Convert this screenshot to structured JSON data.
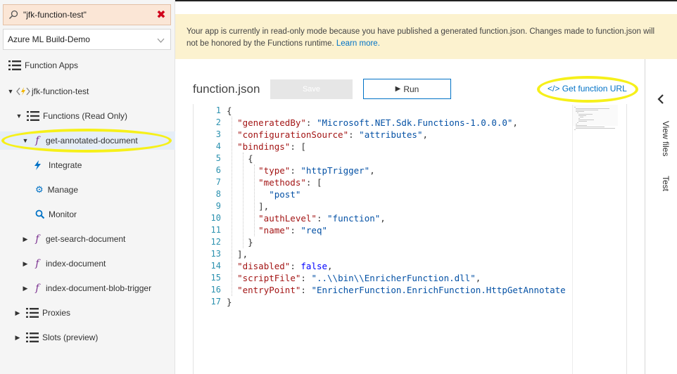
{
  "sidebar": {
    "search_value": "\"jfk-function-test\"",
    "subscription": "Azure ML Build-Demo",
    "function_apps_label": "Function Apps",
    "app_name": "jfk-function-test",
    "functions_label": "Functions (Read Only)",
    "selected_function": "get-annotated-document",
    "integrate_label": "Integrate",
    "manage_label": "Manage",
    "monitor_label": "Monitor",
    "other_functions": [
      "get-search-document",
      "index-document",
      "index-document-blob-trigger"
    ],
    "proxies_label": "Proxies",
    "slots_label": "Slots (preview)"
  },
  "banner": {
    "text": "Your app is currently in read-only mode because you have published a generated function.json. Changes made to function.json will not be honored by the Functions runtime.",
    "link": "Learn more."
  },
  "editor": {
    "title": "function.json",
    "save_label": "Save",
    "run_label": "Run",
    "get_url_label": "Get function URL",
    "line_numbers": [
      "1",
      "2",
      "3",
      "4",
      "5",
      "6",
      "7",
      "8",
      "9",
      "10",
      "11",
      "12",
      "13",
      "14",
      "15",
      "16",
      "17"
    ],
    "lines": [
      "{",
      "  \"generatedBy\": \"Microsoft.NET.Sdk.Functions-1.0.0.0\",",
      "  \"configurationSource\": \"attributes\",",
      "  \"bindings\": [",
      "    {",
      "      \"type\": \"httpTrigger\",",
      "      \"methods\": [",
      "        \"post\"",
      "      ],",
      "      \"authLevel\": \"function\",",
      "      \"name\": \"req\"",
      "    }",
      "  ],",
      "  \"disabled\": false,",
      "  \"scriptFile\": \"..\\\\bin\\\\EnricherFunction.dll\",",
      "  \"entryPoint\": \"EnricherFunction.EnrichFunction.HttpGetAnnotate",
      "}"
    ]
  },
  "right_rail": {
    "view_files_label": "View files",
    "test_label": "Test"
  },
  "colors": {
    "banner_bg": "#fcf2cf",
    "accent": "#0072c6",
    "highlight": "#f6f01a",
    "search_bg": "#fbe6d6",
    "selected_row_bg": "#e6eef7"
  }
}
